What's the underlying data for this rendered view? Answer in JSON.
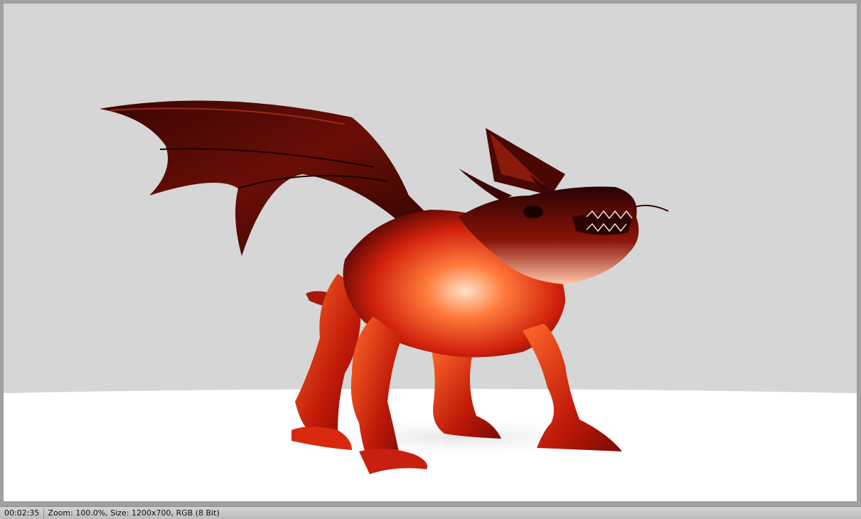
{
  "status": {
    "time": "00:02:35",
    "info": "Zoom: 100.0%, Size: 1200x700, RGB (8 Bit)"
  },
  "render": {
    "subject": "dragon-render",
    "colors": {
      "background": "#d6d6d6",
      "floor": "#ffffff",
      "body_dark": "#5a0a04",
      "body_mid": "#c8200c",
      "body_bright": "#ff5a24",
      "body_glow": "#ffd2b0"
    }
  }
}
